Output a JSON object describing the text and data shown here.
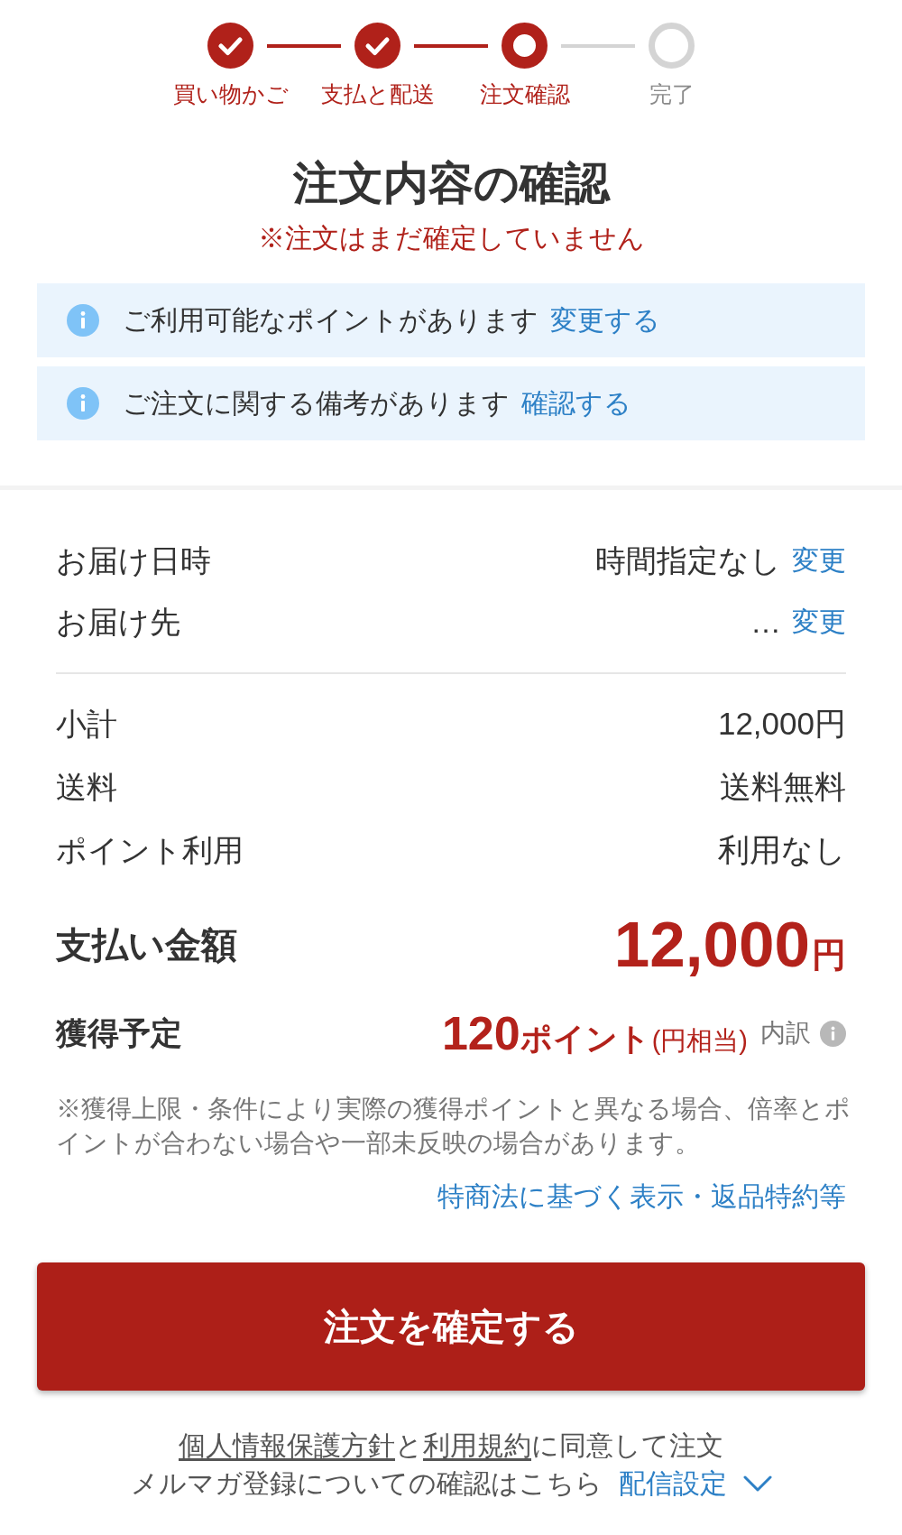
{
  "stepper": {
    "steps": [
      {
        "label": "買い物かご",
        "kind": "done"
      },
      {
        "label": "支払と配送",
        "kind": "done"
      },
      {
        "label": "注文確認",
        "kind": "current"
      },
      {
        "label": "完了",
        "kind": "pending"
      }
    ]
  },
  "header": {
    "title": "注文内容の確認",
    "warning": "※注文はまだ確定していません"
  },
  "notices": [
    {
      "text": "ご利用可能なポイントがあります",
      "link": "変更する"
    },
    {
      "text": "ご注文に関する備考があります",
      "link": "確認する"
    }
  ],
  "delivery": [
    {
      "label": "お届け日時",
      "value": "時間指定なし",
      "link": "変更"
    },
    {
      "label": "お届け先",
      "value": "…",
      "link": "変更"
    }
  ],
  "charges": [
    {
      "label": "小計",
      "value": "12,000円"
    },
    {
      "label": "送料",
      "value": "送料無料"
    },
    {
      "label": "ポイント利用",
      "value": "利用なし"
    }
  ],
  "total": {
    "label": "支払い金額",
    "amount": "12,000",
    "unit": "円"
  },
  "points": {
    "label": "獲得予定",
    "amount": "120",
    "unit": "ポイント",
    "note": "(円相当)",
    "breakdown": "内訳"
  },
  "disclaimer": "※獲得上限・条件により実際の獲得ポイントと異なる場合、倍率とポイントが合わない場合や一部未反映の場合があります。",
  "legal_link": "特商法に基づく表示・返品特約等",
  "confirm_button": "注文を確定する",
  "agreement": {
    "segments": [
      {
        "kind": "link",
        "text": "個人情報保護方針"
      },
      {
        "kind": "text",
        "text": "と"
      },
      {
        "kind": "link",
        "text": "利用規約"
      },
      {
        "kind": "text",
        "text": "に同意して注文"
      }
    ]
  },
  "newsletter": {
    "text": "メルマガ登録についての確認はこちら",
    "link": "配信設定"
  }
}
